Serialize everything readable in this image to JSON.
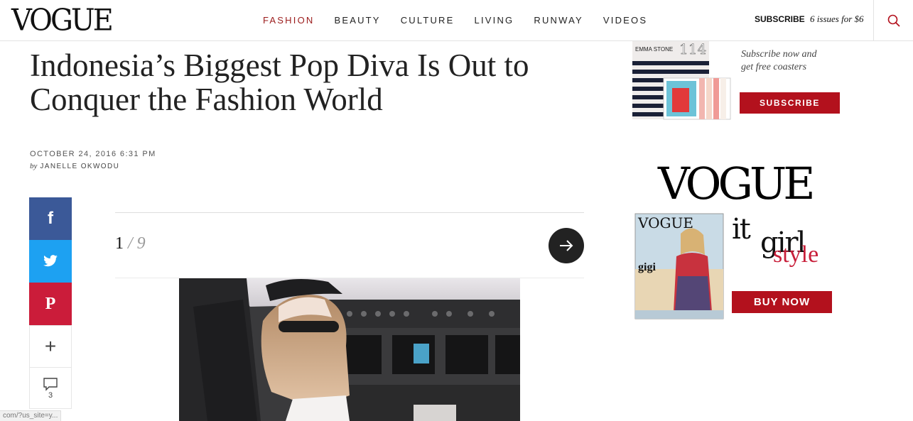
{
  "header": {
    "logo": "VOGUE",
    "nav": [
      "FASHION",
      "BEAUTY",
      "CULTURE",
      "LIVING",
      "RUNWAY",
      "VIDEOS"
    ],
    "active_nav": "FASHION",
    "subscribe_label": "SUBSCRIBE",
    "subscribe_offer": "6 issues for $6",
    "search_icon": "search-icon"
  },
  "article": {
    "headline": "Indonesia’s Biggest Pop Diva Is Out to Conquer the Fashion World",
    "date": "OCTOBER 24, 2016 6:31 PM",
    "byline_prefix": "by",
    "author": "JANELLE OKWODU"
  },
  "share": {
    "facebook": "f",
    "twitter_icon": "twitter-icon",
    "pinterest": "P",
    "more": "+",
    "comment_count": "3"
  },
  "gallery": {
    "current": "1",
    "total": "/ 9",
    "next_icon": "arrow-right-icon"
  },
  "sidebar": {
    "promo_cover_text_1": "EMMA STONE",
    "promo_cover_issue": "114",
    "promo_copy_line1": "Subscribe now and",
    "promo_copy_line2": "get free coasters",
    "subscribe_button": "SUBSCRIBE",
    "ad_logo": "VOGUE",
    "ad_cover_title": "VOGUE",
    "ad_cover_sub": "gigi",
    "ad_it": "it",
    "ad_girl": "girl",
    "ad_style": "style",
    "buy_button": "BUY NOW"
  },
  "status_bar": "com/?us_site=y..."
}
